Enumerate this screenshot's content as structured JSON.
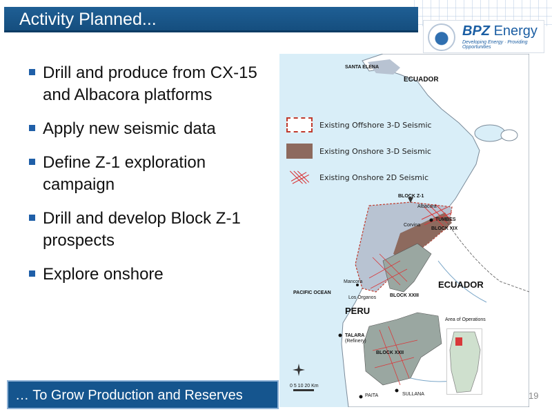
{
  "header": {
    "title": "Activity Planned..."
  },
  "logo": {
    "name": "BPZ",
    "name_suffix": "Energy",
    "tagline": "Developing Energy · Providing Opportunities"
  },
  "bullets": [
    "Drill and produce from CX-15 and Albacora platforms",
    "Apply new seismic data",
    "Define Z-1 exploration campaign",
    "Drill and develop Block Z-1 prospects",
    "Explore onshore"
  ],
  "banner": {
    "text": "… To Grow Production and Reserves"
  },
  "page_number": "19",
  "map": {
    "legend": [
      {
        "label": "Existing Offshore 3-D Seismic",
        "swatch": "offshore-dashed"
      },
      {
        "label": "Existing Onshore 3-D Seismic",
        "swatch": "onshore-brown"
      },
      {
        "label": "Existing Onshore 2D Seismic",
        "swatch": "onshore-2d-hatch"
      }
    ],
    "labels": {
      "santa_elena": "SANTA ELENA",
      "ecuador_top": "ECUADOR",
      "block_z1": "BLOCK Z-1",
      "albacora": "Albacora",
      "tumbes": "TUMBES",
      "corvina": "Corvina",
      "block_xix": "BLOCK XIX",
      "pacific_ocean": "PACIFIC OCEAN",
      "mancora": "Mancora",
      "los_organos": "Los Organos",
      "block_xxiii": "BLOCK XXIII",
      "ecuador_mid": "ECUADOR",
      "peru": "PERU",
      "talara": "TALARA",
      "talara_sub": "(Refinery)",
      "block_xxii": "BLOCK XXII",
      "sullana": "SULLANA",
      "paita": "PAITA",
      "area_of_operations": "Area of Operations",
      "scale": "0  5  10  20 Km"
    },
    "colors": {
      "sea": "#d9eef8",
      "land": "#ffffff",
      "offshore_block": "#b8c3d2",
      "onshore_3d": "#8d6a5e",
      "seismic_2d": "#d9383a",
      "onshore_block": "#9aa7a1"
    }
  }
}
